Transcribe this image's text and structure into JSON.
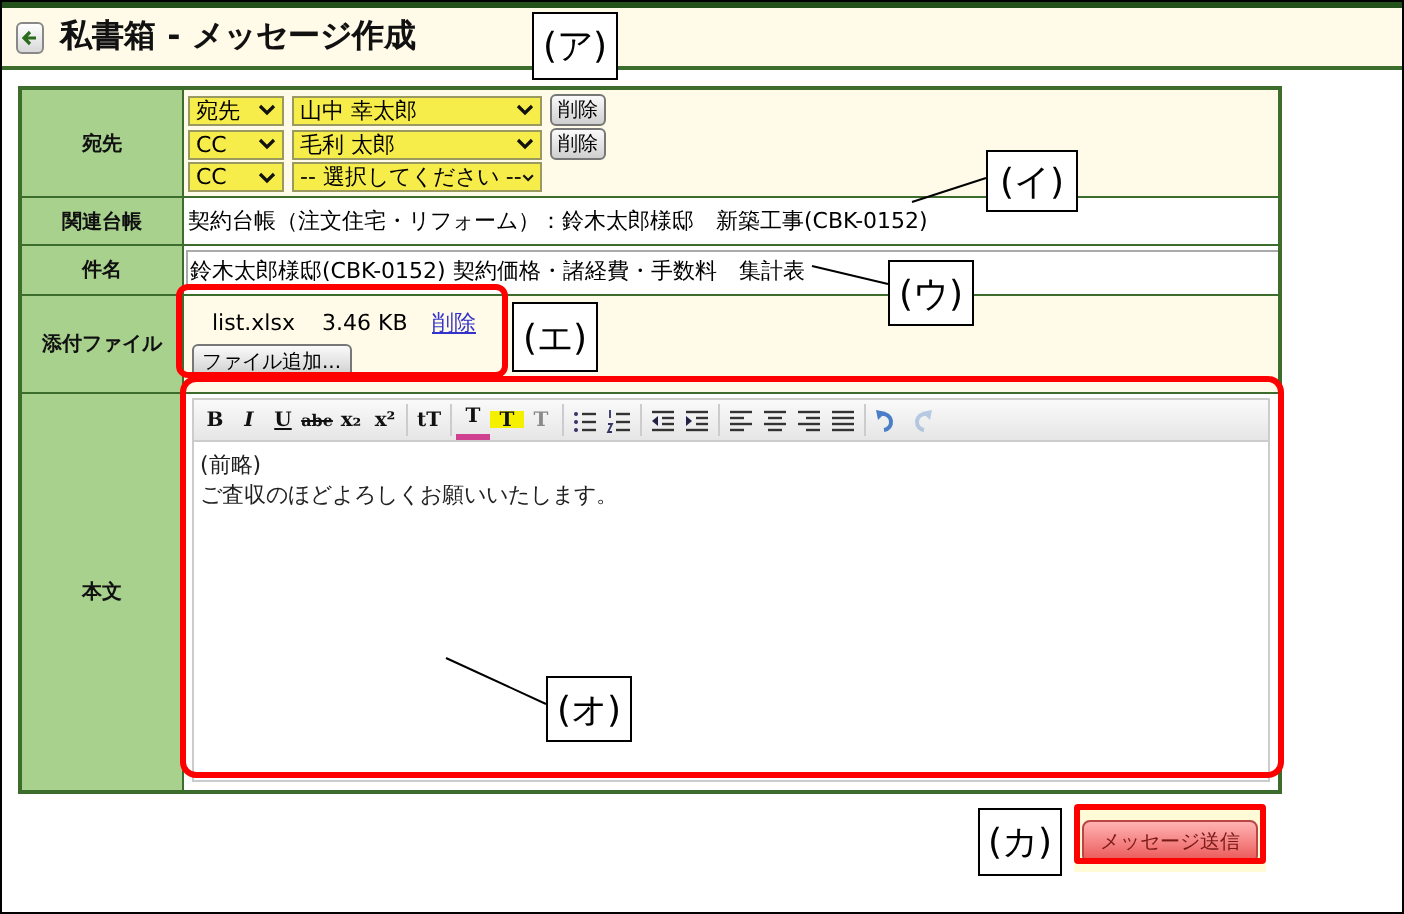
{
  "header": {
    "title": "私書箱 - メッセージ作成"
  },
  "form": {
    "recipients": {
      "label": "宛先",
      "rows": [
        {
          "type": "宛先",
          "name": "山中 幸太郎",
          "delete": "削除"
        },
        {
          "type": "CC",
          "name": "毛利 太郎",
          "delete": "削除"
        },
        {
          "type": "CC",
          "name": "-- 選択してください --"
        }
      ]
    },
    "ledger": {
      "label": "関連台帳",
      "value": "契約台帳（注文住宅・リフォーム）：鈴木太郎様邸　新築工事(CBK-0152)"
    },
    "subject": {
      "label": "件名",
      "value": "鈴木太郎様邸(CBK-0152) 契約価格・諸経費・手数料　集計表"
    },
    "attachments": {
      "label": "添付ファイル",
      "files": [
        {
          "name": "list.xlsx",
          "size": "3.46 KB",
          "delete": "削除"
        }
      ],
      "add_button": "ファイル追加..."
    },
    "body": {
      "label": "本文",
      "toolbar": [
        {
          "kind": "bold",
          "label": "B",
          "disabled": false
        },
        {
          "kind": "italic",
          "label": "I",
          "disabled": false
        },
        {
          "kind": "underline",
          "label": "U",
          "disabled": false
        },
        {
          "kind": "strike",
          "label": "abe",
          "disabled": false
        },
        {
          "kind": "subscript",
          "label": "x₂",
          "disabled": false
        },
        {
          "kind": "superscript",
          "label": "x²",
          "disabled": false
        },
        {
          "kind": "fontsize",
          "label": "tT",
          "disabled": false
        },
        {
          "kind": "textcolor",
          "label": "T",
          "disabled": false
        },
        {
          "kind": "highlight",
          "label": "T",
          "disabled": false
        },
        {
          "kind": "clear",
          "label": "T",
          "disabled": true
        },
        {
          "kind": "bullets",
          "disabled": false
        },
        {
          "kind": "numbers",
          "disabled": false
        },
        {
          "kind": "outdent",
          "disabled": false
        },
        {
          "kind": "indent",
          "disabled": false
        },
        {
          "kind": "left",
          "disabled": false
        },
        {
          "kind": "center",
          "disabled": false
        },
        {
          "kind": "right",
          "disabled": false
        },
        {
          "kind": "justify",
          "disabled": false
        },
        {
          "kind": "undo",
          "disabled": false
        },
        {
          "kind": "redo",
          "disabled": true
        }
      ],
      "lines": [
        "(前略)",
        "ご査収のほどよろしくお願いいたします。"
      ]
    }
  },
  "send_button": "メッセージ送信",
  "callouts": [
    {
      "label": "(ア)"
    },
    {
      "label": "(イ)"
    },
    {
      "label": "(ウ)"
    },
    {
      "label": "(エ)"
    },
    {
      "label": "(オ)"
    },
    {
      "label": "(カ)"
    }
  ]
}
